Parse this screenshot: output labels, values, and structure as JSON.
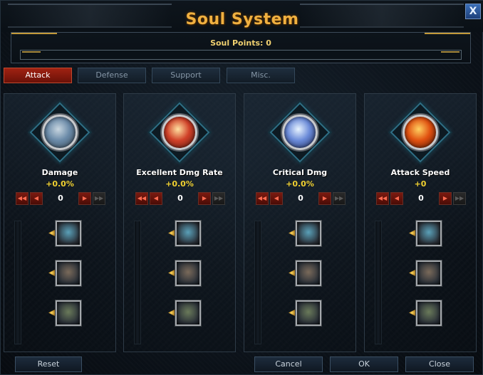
{
  "window": {
    "title": "Soul System",
    "close_label": "X"
  },
  "soul_points": {
    "label": "Soul Points:",
    "value": "0",
    "fill_fraction": 0.0
  },
  "tabs": [
    {
      "label": "Attack",
      "active": true
    },
    {
      "label": "Defense",
      "active": false
    },
    {
      "label": "Support",
      "active": false
    },
    {
      "label": "Misc.",
      "active": false
    }
  ],
  "skills": [
    {
      "name": "Damage",
      "value": "+0.0%",
      "count": "0",
      "icon": "winged-gauntlet-icon",
      "orb_colors": [
        "#c8d6e0",
        "#6a8aa8",
        "#3a4a58"
      ],
      "sub_skills": [
        "blue-cross-icon",
        "blue-fist-icon",
        "claw-grip-icon"
      ]
    },
    {
      "name": "Excellent Dmg Rate",
      "value": "+0.0%",
      "count": "0",
      "icon": "flame-fist-icon",
      "orb_colors": [
        "#ffe0a0",
        "#d04028",
        "#5a1a10"
      ],
      "sub_skills": [
        "pale-claw-icon",
        "feather-slash-icon",
        "armored-head-icon"
      ]
    },
    {
      "name": "Critical Dmg",
      "value": "+0.0%",
      "count": "0",
      "icon": "lightning-blade-icon",
      "orb_colors": [
        "#e8f4ff",
        "#6a8ad8",
        "#1e2a5a"
      ],
      "sub_skills": [
        "crossed-claws-icon",
        "green-mask-icon",
        "stone-beast-icon"
      ]
    },
    {
      "name": "Attack Speed",
      "value": "+0",
      "count": "0",
      "icon": "fire-burst-icon",
      "orb_colors": [
        "#ffd060",
        "#e05010",
        "#501808"
      ],
      "sub_skills": [
        "dark-knight-icon",
        "blue-spiral-icon",
        "red-scythe-icon"
      ]
    }
  ],
  "controls": {
    "first": "◀◀",
    "prev": "◀",
    "next": "▶",
    "last": "▶▶"
  },
  "footer": {
    "reset": "Reset",
    "cancel": "Cancel",
    "ok": "OK",
    "close": "Close"
  }
}
